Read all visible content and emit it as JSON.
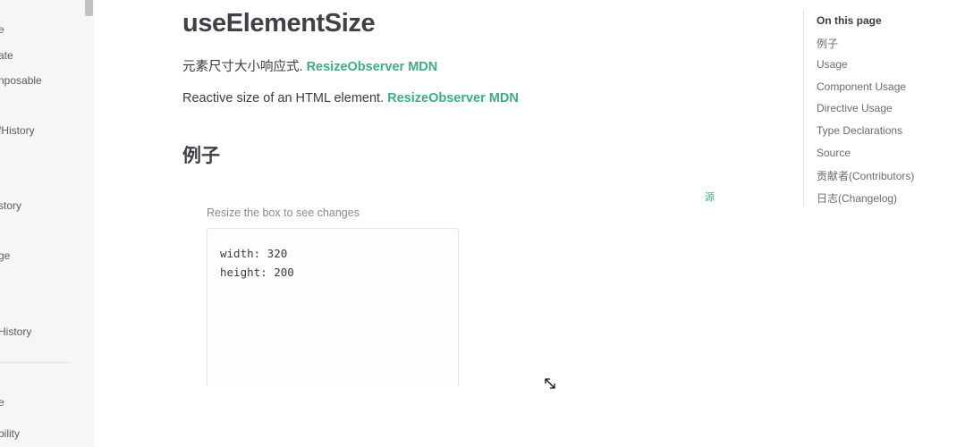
{
  "sidebar": {
    "items": [
      {
        "label": "e"
      },
      {
        "label": "ate"
      },
      {
        "label": "nposable"
      },
      {
        "label": "fHistory"
      },
      {
        "label": "story"
      },
      {
        "label": "ge"
      },
      {
        "label": "History"
      },
      {
        "label": "e"
      },
      {
        "label": "bility"
      }
    ]
  },
  "main": {
    "title": "useElementSize",
    "intro_zh": {
      "text": "元素尺寸大小响应式. ",
      "link": "ResizeObserver MDN"
    },
    "intro_en": {
      "text": "Reactive size of an HTML element. ",
      "link": "ResizeObserver MDN"
    },
    "section_heading": "例子",
    "demo": {
      "source_link": "源",
      "hint": "Resize the box to see changes",
      "width_line": "width: 320",
      "height_line": "height: 200"
    }
  },
  "aside": {
    "title": "On this page",
    "links": [
      {
        "label": "例子"
      },
      {
        "label": "Usage"
      },
      {
        "label": "Component Usage"
      },
      {
        "label": "Directive Usage"
      },
      {
        "label": "Type Declarations"
      },
      {
        "label": "Source"
      },
      {
        "label": "贡献者(Contributors)"
      },
      {
        "label": "日志(Changelog)"
      }
    ]
  },
  "colors": {
    "brand": "#3eaf7c",
    "sidebar_bg": "#f6f6f7",
    "text": "#3c3c43"
  }
}
